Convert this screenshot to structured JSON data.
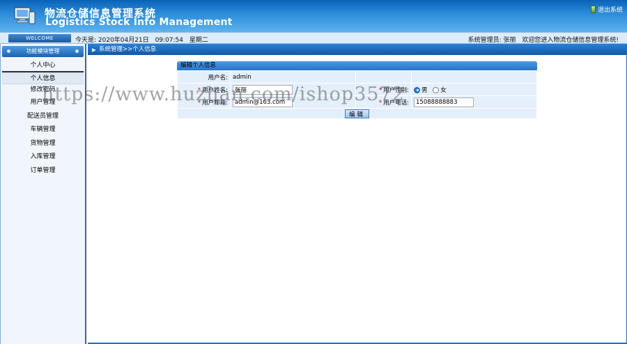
{
  "header": {
    "title_cn": "物流仓储信息管理系统",
    "title_en": "Logistics Stock Info Management",
    "logout_label": "退出系统"
  },
  "infobar": {
    "welcome_label": "WELCOME",
    "date_prefix": "今天是: 2020年04月21日",
    "time": "09:07:54",
    "weekday": "星期二",
    "admin_label": "系统管理员: 张丽",
    "welcome_message": "欢迎您进入物流仓储信息管理系统!"
  },
  "sidebar": {
    "header": "功能模块管理",
    "group_label": "个人中心",
    "sub_items": [
      {
        "label": "个人信息",
        "active": true
      },
      {
        "label": "修改密码",
        "active": false
      }
    ],
    "items": [
      {
        "label": "用户管理"
      },
      {
        "label": "配送员管理"
      },
      {
        "label": "车辆管理"
      },
      {
        "label": "货物管理"
      },
      {
        "label": "入库管理"
      },
      {
        "label": "订单管理"
      }
    ]
  },
  "main": {
    "breadcrumb": "系统管理>>个人信息",
    "panel_title": "编辑个人信息",
    "form": {
      "username_label": "用户名:",
      "username_value": "admin",
      "realname_label": "用户姓名:",
      "realname_value": "张丽",
      "gender_label": "用户性别:",
      "gender_male": "男",
      "gender_female": "女",
      "gender_selected": "男",
      "email_label": "用户邮箱:",
      "email_value": "admin@163.com",
      "phone_label": "用户电话:",
      "phone_value": "15088888883",
      "required_mark": "*",
      "edit_button": "编辑"
    }
  },
  "watermark": "https://www.huzhan.com/ishop3572"
}
